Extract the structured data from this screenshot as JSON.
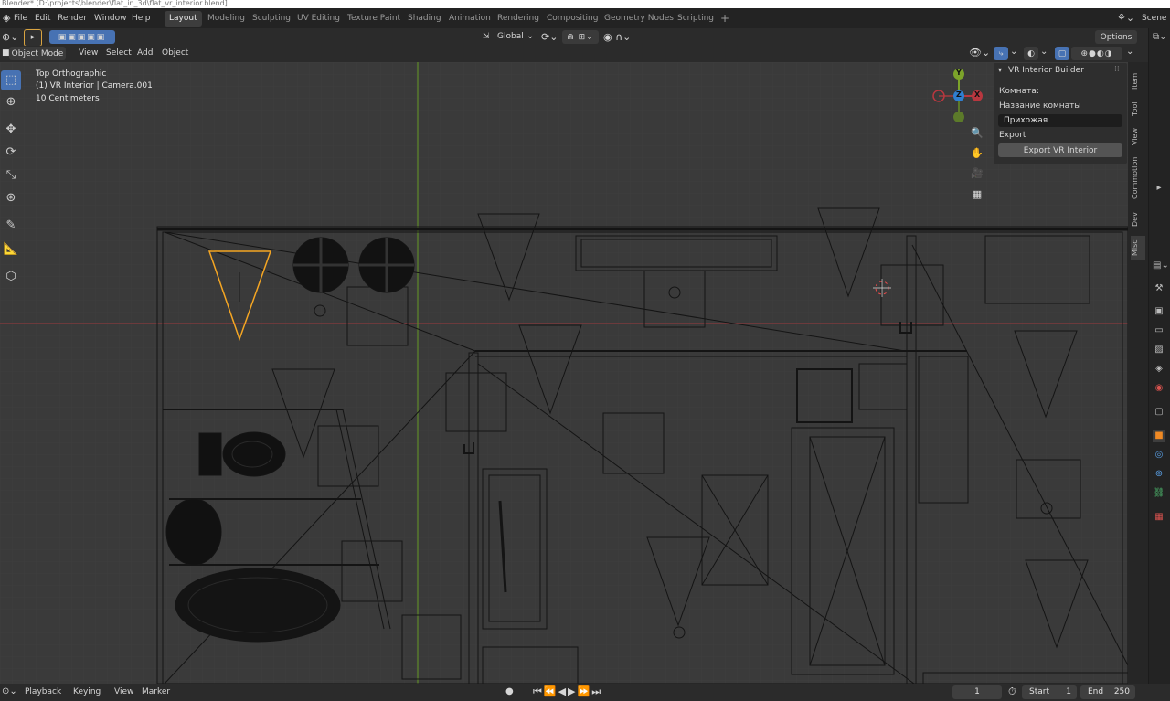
{
  "window": {
    "title": "Blender* [D:\\projects\\blender\\flat_in_3d\\flat_vr_interior.blend]"
  },
  "menu": [
    "File",
    "Edit",
    "Render",
    "Window",
    "Help"
  ],
  "workspaces": [
    "Layout",
    "Modeling",
    "Sculpting",
    "UV Editing",
    "Texture Paint",
    "Shading",
    "Animation",
    "Rendering",
    "Compositing",
    "Geometry Nodes",
    "Scripting"
  ],
  "active_workspace": "Layout",
  "scene_label": "Scene",
  "header": {
    "transform_orientation": "Global",
    "options_label": "Options"
  },
  "header2": {
    "mode": "Object Mode",
    "menus": [
      "View",
      "Select",
      "Add",
      "Object"
    ]
  },
  "viewport_info": {
    "view_name": "Top Orthographic",
    "collection": "(1) VR Interior | Camera.001",
    "scale": "10 Centimeters"
  },
  "gizmo": {
    "y": "Y",
    "z": "Z",
    "x": "X"
  },
  "npanel": {
    "title": "VR Interior Builder",
    "room_label": "Комната:",
    "room_name_label": "Название комнаты",
    "room_name_value": "Прихожая",
    "export_label": "Export",
    "export_button": "Export VR Interior"
  },
  "n_tabs": [
    "Item",
    "Tool",
    "View",
    "Commotion",
    "Dev",
    "Misc"
  ],
  "timeline": {
    "menus": [
      "Playback",
      "Keying",
      "View",
      "Marker"
    ],
    "current_frame": "1",
    "start_label": "Start",
    "start_value": "1",
    "end_label": "End",
    "end_value": "250"
  },
  "colors": {
    "accent": "#4772b3",
    "selected_camera": "#f5a623",
    "x_axis": "#b8373f",
    "y_axis": "#7ca32a",
    "z_axis": "#2f7fd1"
  }
}
